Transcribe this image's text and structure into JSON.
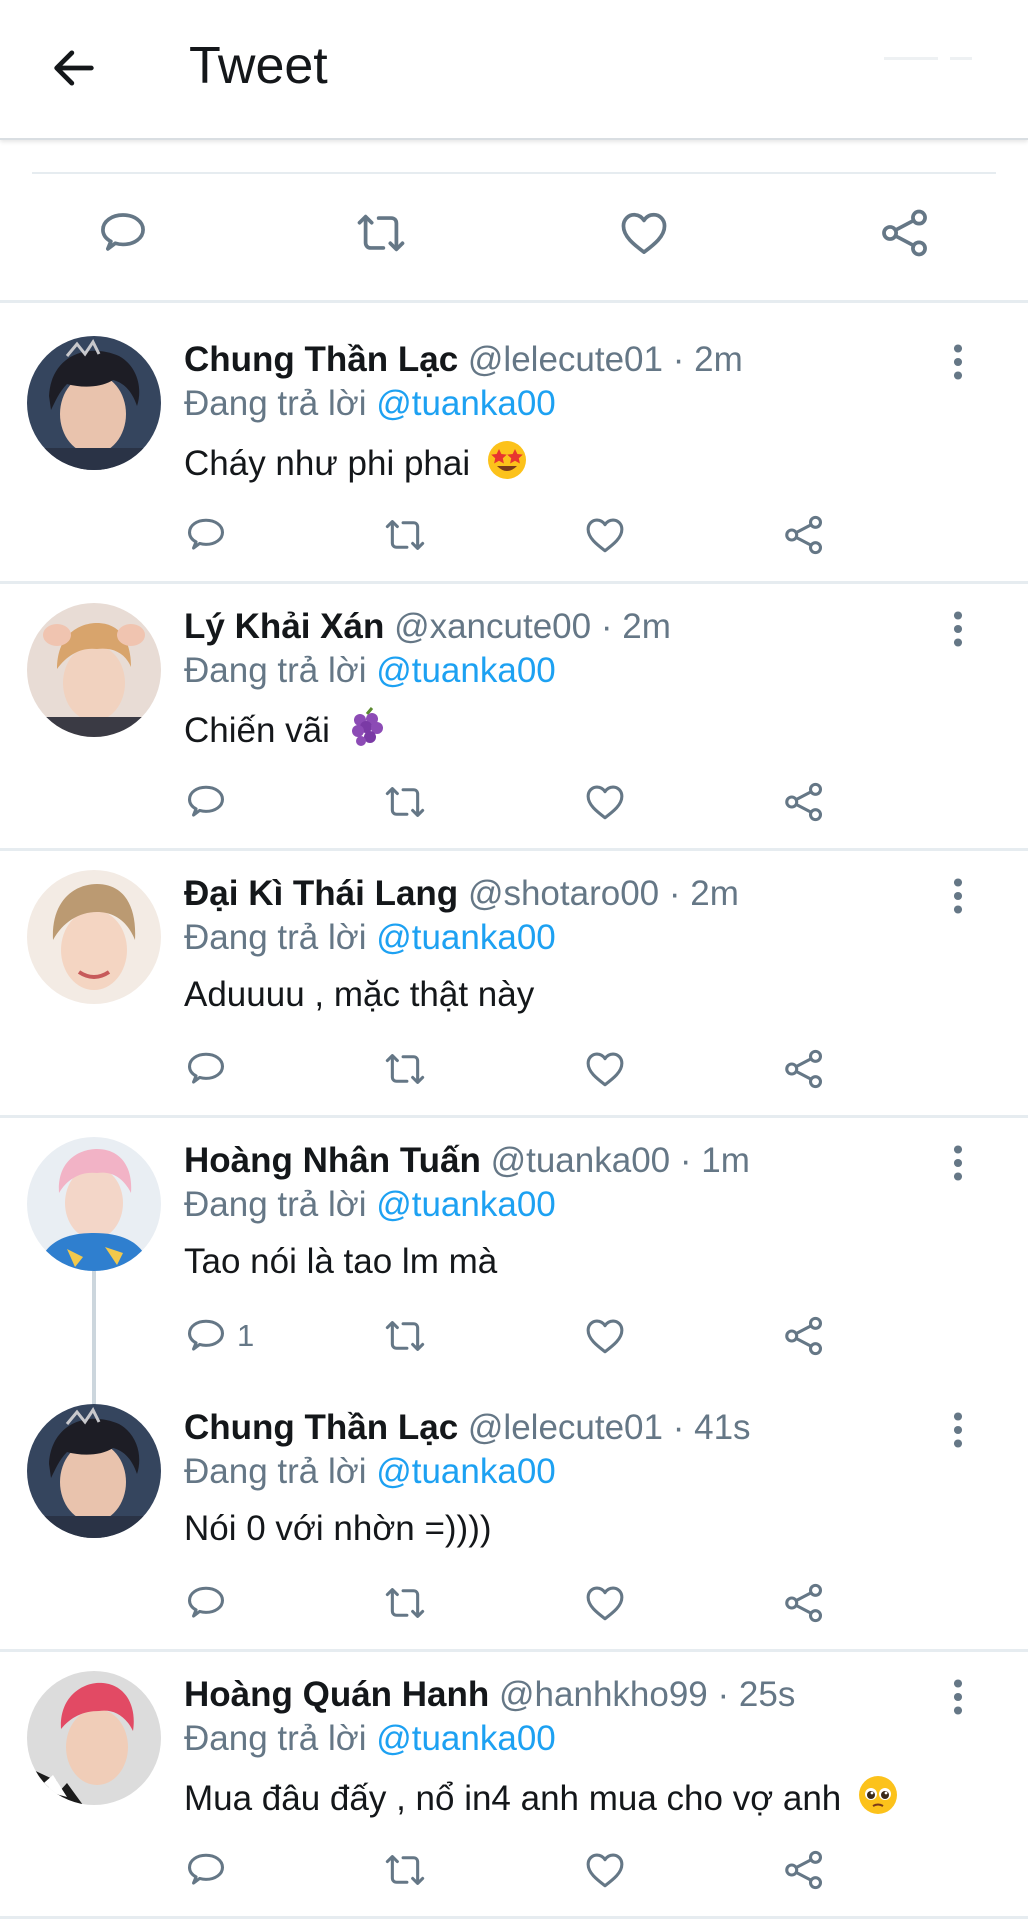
{
  "header": {
    "title": "Tweet"
  },
  "icons": {
    "back": "arrow-left-icon",
    "reply": "speech-bubble-icon",
    "retweet": "retweet-arrows-icon",
    "like": "heart-outline-icon",
    "share": "share-nodes-icon",
    "more": "vertical-dots-icon"
  },
  "colors": {
    "link": "#1da1f2",
    "secondary": "#657786",
    "icon": "#657786",
    "text": "#14171a",
    "divider": "#e6ecf0"
  },
  "tweets": [
    {
      "name": "Chung Thần Lạc",
      "handle": "@lelecute01",
      "sep": "·",
      "time": "2m",
      "reply_prefix": "Đang trả lời",
      "reply_to": "@tuanka00",
      "text": "Cháy như phi phai",
      "emoji": "star-struck-emoji",
      "reply_count": ""
    },
    {
      "name": "Lý Khải Xán",
      "handle": "@xancute00",
      "sep": "·",
      "time": "2m",
      "reply_prefix": "Đang trả lời",
      "reply_to": "@tuanka00",
      "text": "Chiến vãi",
      "emoji": "grapes-emoji",
      "reply_count": ""
    },
    {
      "name": "Đại Kì Thái Lang",
      "handle": "@shotaro00",
      "sep": "·",
      "time": "2m",
      "reply_prefix": "Đang trả lời",
      "reply_to": "@tuanka00",
      "text": "Aduuuu , mặc thật này",
      "emoji": "",
      "reply_count": ""
    },
    {
      "name": "Hoàng Nhân Tuấn",
      "handle": "@tuanka00",
      "sep": "·",
      "time": "1m",
      "reply_prefix": "Đang trả lời",
      "reply_to": "@tuanka00",
      "text": "Tao nói là tao lm mà",
      "emoji": "",
      "reply_count": "1"
    },
    {
      "name": "Chung Thần Lạc",
      "handle": "@lelecute01",
      "sep": "·",
      "time": "41s",
      "reply_prefix": "Đang trả lời",
      "reply_to": "@tuanka00",
      "text": "Nói 0 với nhờn =))))",
      "emoji": "",
      "reply_count": ""
    },
    {
      "name": "Hoàng Quán Hanh",
      "handle": "@hanhkho99",
      "sep": "·",
      "time": "25s",
      "reply_prefix": "Đang trả lời",
      "reply_to": "@tuanka00",
      "text": "Mua đâu đấy , nổ in4 anh mua cho vợ anh",
      "emoji": "pleading-face-emoji",
      "reply_count": ""
    }
  ]
}
